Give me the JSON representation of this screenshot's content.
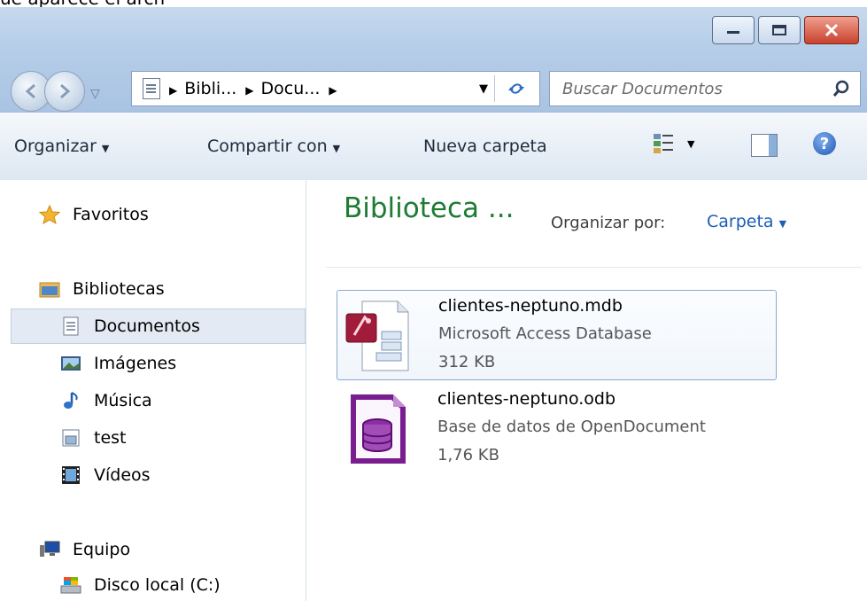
{
  "top_strip_text": "ue aparece el arch",
  "window": {
    "controls": [
      "minimize",
      "maximize",
      "close"
    ]
  },
  "address_bar": {
    "crumbs": [
      "Bibli...",
      "Docu..."
    ],
    "icons": [
      "documents-library-icon",
      "dropdown-arrow-icon",
      "refresh-icon"
    ]
  },
  "search": {
    "placeholder": "Buscar Documentos"
  },
  "command_bar": {
    "organize": "Organizar",
    "share": "Compartir con",
    "new_folder": "Nueva carpeta"
  },
  "nav": {
    "favorites": "Favoritos",
    "libraries": "Bibliotecas",
    "documents": "Documentos",
    "images": "Imágenes",
    "music": "Música",
    "test": "test",
    "videos": "Vídeos",
    "computer": "Equipo",
    "local_disk": "Disco local (C:)"
  },
  "content": {
    "title": "Biblioteca ...",
    "arrange_label": "Organizar por:",
    "arrange_value": "Carpeta",
    "files": [
      {
        "name": "clientes-neptuno.mdb",
        "type": "Microsoft Access Database",
        "size": "312 KB"
      },
      {
        "name": "clientes-neptuno.odb",
        "type": "Base de datos de OpenDocument",
        "size": "1,76 KB"
      }
    ]
  },
  "colors": {
    "accent_title": "#1e7b34",
    "link": "#1d5fb4",
    "selection": "#e3eaf4"
  }
}
